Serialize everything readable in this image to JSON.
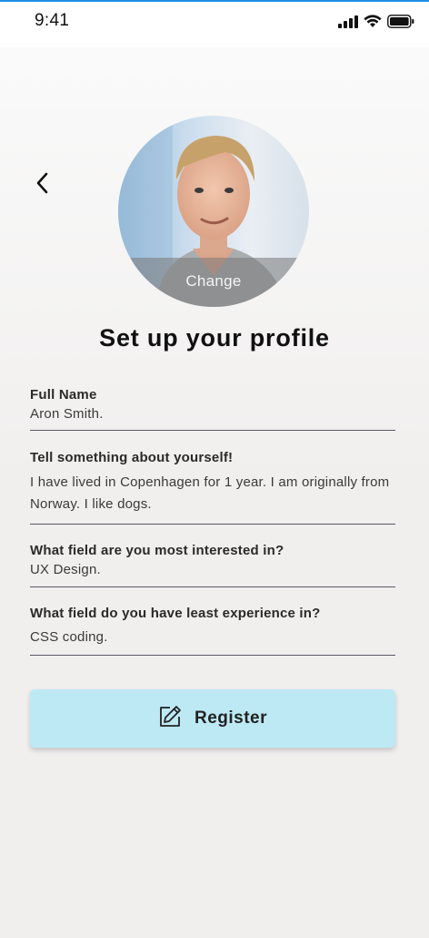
{
  "status_bar": {
    "time": "9:41",
    "icons": [
      "signal-icon",
      "wifi-icon",
      "battery-icon"
    ]
  },
  "header": {
    "back_icon": "chevron-left-icon",
    "avatar_change_label": "Change",
    "title": "Set up your profile"
  },
  "form": {
    "fields": [
      {
        "label": "Full Name",
        "value": "Aron Smith."
      },
      {
        "label": "Tell something about yourself!",
        "value": "I have lived in Copenhagen for 1 year. I am originally from Norway. I like dogs."
      },
      {
        "label": "What field are you most interested in?",
        "value": "UX Design."
      },
      {
        "label": "What field do you have least experience in?",
        "value": "CSS coding."
      }
    ]
  },
  "register": {
    "label": "Register",
    "icon": "edit-pencil-icon",
    "background": "#bde9f5"
  },
  "colors": {
    "accent_top": "#1e90e6",
    "field_underline": "#5b5866",
    "page_background": "#f1efee"
  }
}
